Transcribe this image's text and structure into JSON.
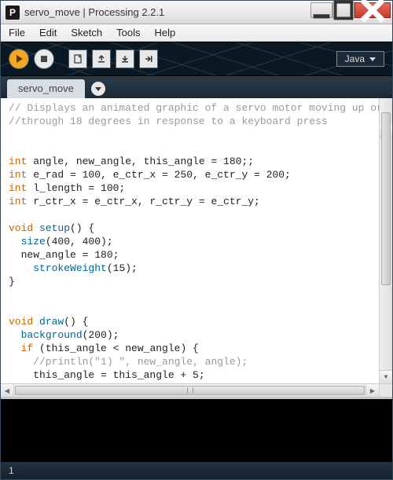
{
  "window": {
    "appicon_letter": "P",
    "title": "servo_move | Processing 2.2.1"
  },
  "menu": {
    "file": "File",
    "edit": "Edit",
    "sketch": "Sketch",
    "tools": "Tools",
    "help": "Help"
  },
  "toolbar": {
    "mode_label": "Java"
  },
  "tab": {
    "name": "servo_move"
  },
  "code": {
    "c1": "// Displays an animated graphic of a servo motor moving up or down",
    "c2": "//through 18 degrees in response to a keyboard press",
    "blank": "",
    "l1a": "int",
    "l1b": " angle, new_angle, this_angle = 180;;",
    "l2a": "int",
    "l2b": " e_rad = 100, e_ctr_x = 250, e_ctr_y = 200;",
    "l3a": "int",
    "l3b": " l_length = 100;",
    "l4a": "int",
    "l4b": " r_ctr_x = e_ctr_x, r_ctr_y = e_ctr_y;",
    "l5a": "void",
    "l5b": " ",
    "l5c": "setup",
    "l5d": "() {",
    "l6a": "  ",
    "l6b": "size",
    "l6c": "(400, 400);",
    "l7": "  new_angle = 180;",
    "l8a": "    ",
    "l8b": "strokeWeight",
    "l8c": "(15);",
    "l9": "}",
    "l10a": "void",
    "l10b": " ",
    "l10c": "draw",
    "l10d": "() {",
    "l11a": "  ",
    "l11b": "background",
    "l11c": "(200);",
    "l12a": "  ",
    "l12b": "if",
    "l12c": " (this_angle < new_angle) {",
    "l13": "    //println(\"1) \", new_angle, angle);",
    "l14": "    this_angle = this_angle + 5;",
    "l15": "  }"
  },
  "status": {
    "line": "1"
  }
}
